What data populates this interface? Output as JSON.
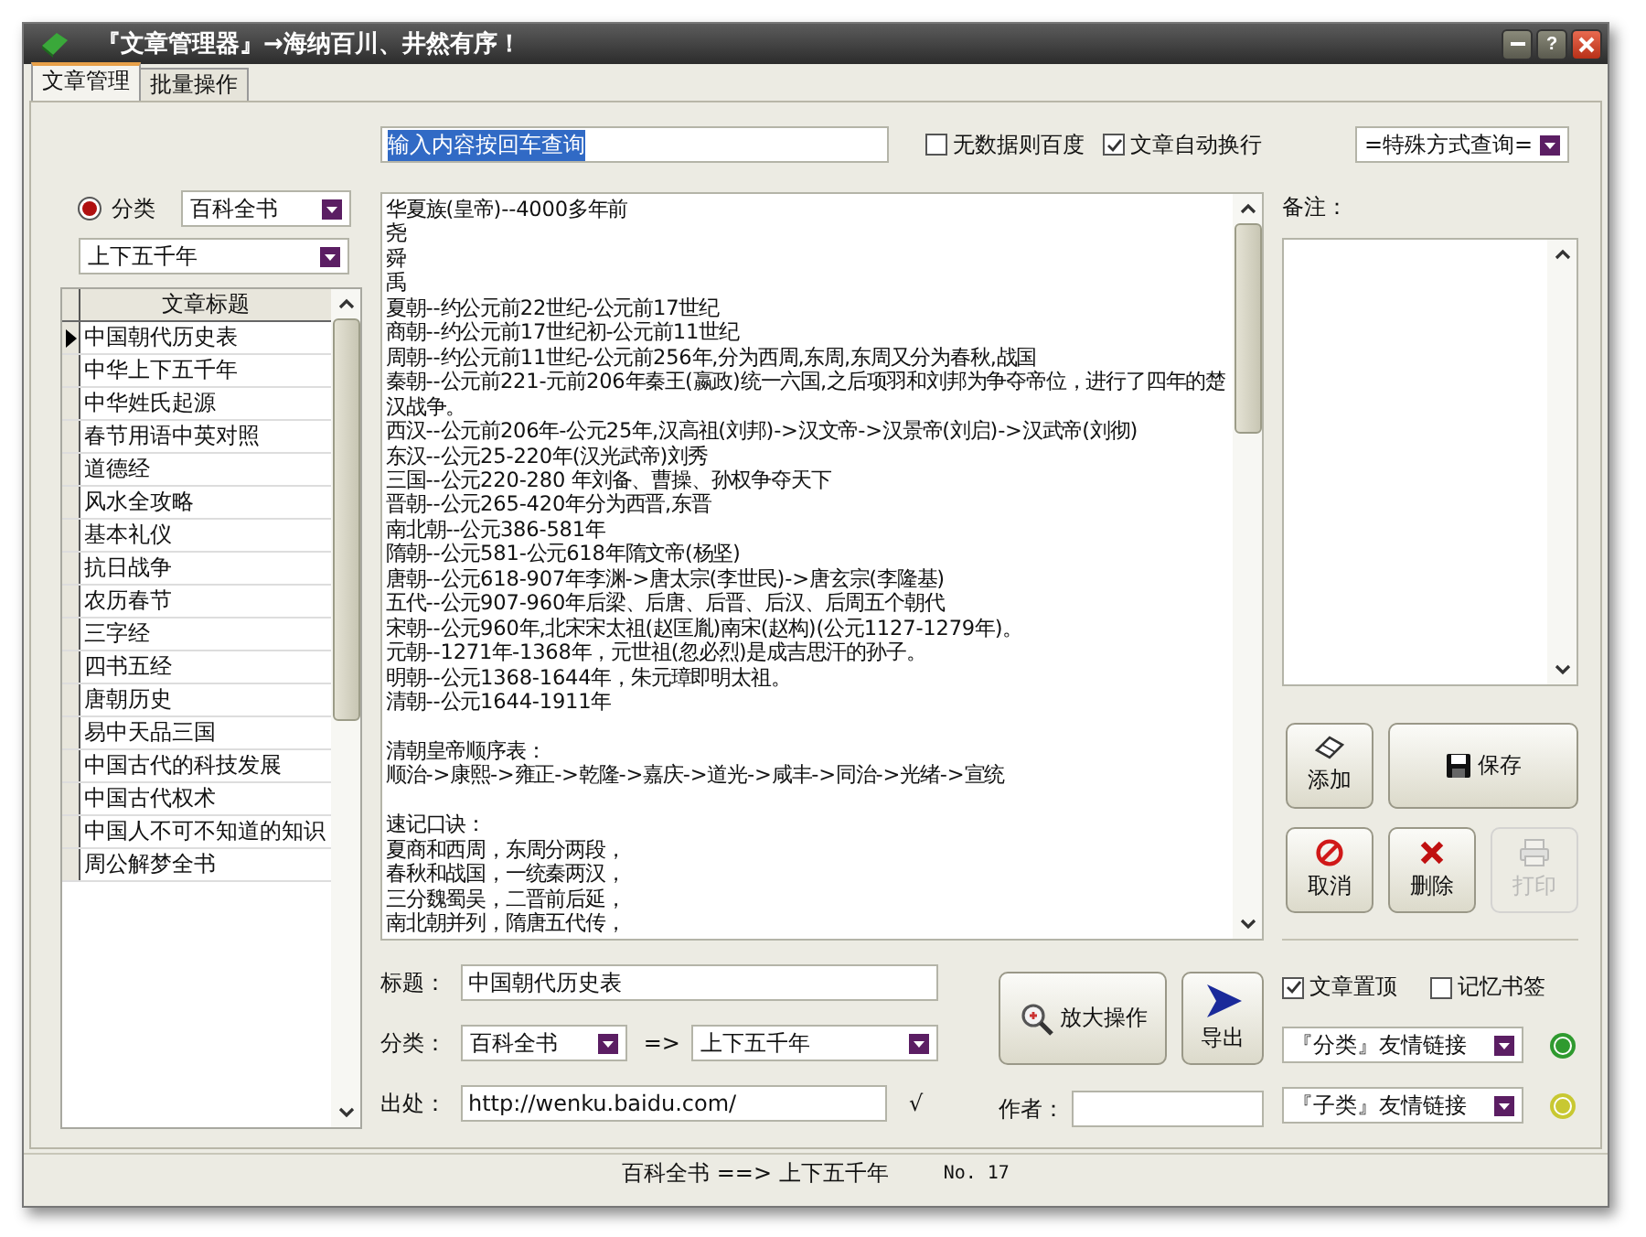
{
  "window": {
    "title": "『文章管理器』→海纳百川、井然有序！",
    "help_button": "?"
  },
  "tabs": [
    {
      "label": "文章管理",
      "selected": true
    },
    {
      "label": "批量操作",
      "selected": false
    }
  ],
  "search": {
    "value": "输入内容按回车查询"
  },
  "top_options": [
    {
      "label": "无数据则百度",
      "checked": false
    },
    {
      "label": "文章自动换行",
      "checked": true
    }
  ],
  "query_mode": {
    "value": "=特殊方式查询="
  },
  "category": {
    "label": "分类",
    "selected": true,
    "value": "百科全书"
  },
  "subcategory": {
    "value": "上下五千年"
  },
  "article_list": {
    "column": "文章标题",
    "rows": [
      {
        "title": "中国朝代历史表",
        "selected": true
      },
      {
        "title": "中华上下五千年",
        "selected": false
      },
      {
        "title": "中华姓氏起源",
        "selected": false
      },
      {
        "title": "春节用语中英对照",
        "selected": false
      },
      {
        "title": "道德经",
        "selected": false
      },
      {
        "title": "风水全攻略",
        "selected": false
      },
      {
        "title": "基本礼仪",
        "selected": false
      },
      {
        "title": "抗日战争",
        "selected": false
      },
      {
        "title": "农历春节",
        "selected": false
      },
      {
        "title": "三字经",
        "selected": false
      },
      {
        "title": "四书五经",
        "selected": false
      },
      {
        "title": "唐朝历史",
        "selected": false
      },
      {
        "title": "易中天品三国",
        "selected": false
      },
      {
        "title": "中国古代的科技发展",
        "selected": false
      },
      {
        "title": "中国古代权术",
        "selected": false
      },
      {
        "title": "中国人不可不知道的知识",
        "selected": false
      },
      {
        "title": "周公解梦全书",
        "selected": false
      }
    ]
  },
  "content": {
    "sections": [
      [
        "华夏族(皇帝)--4000多年前",
        "尧",
        "舜",
        "禹",
        "夏朝--约公元前22世纪-公元前17世纪",
        "商朝--约公元前17世纪初-公元前11世纪",
        "周朝--约公元前11世纪-公元前256年,分为西周,东周,东周又分为春秋,战国",
        "秦朝--公元前221-元前206年秦王(嬴政)统一六国,之后项羽和刘邦为争夺帝位，进行了四年的楚汉战争。",
        "西汉--公元前206年-公元25年,汉高祖(刘邦)->汉文帝->汉景帝(刘启)->汉武帝(刘彻)",
        "东汉--公元25-220年(汉光武帝)刘秀",
        "三国--公元220-280 年刘备、曹操、孙权争夺天下",
        "晋朝--公元265-420年分为西晋,东晋",
        "南北朝--公元386-581年",
        "隋朝--公元581-公元618年隋文帝(杨坚)",
        "唐朝--公元618-907年李渊->唐太宗(李世民)->唐玄宗(李隆基)",
        "五代--公元907-960年后梁、后唐、后晋、后汉、后周五个朝代",
        "宋朝--公元960年,北宋宋太祖(赵匡胤)南宋(赵构)(公元1127-1279年)。",
        "元朝--1271年-1368年，元世祖(忽必烈)是成吉思汗的孙子。",
        "明朝--公元1368-1644年，朱元璋即明太祖。",
        "清朝--公元1644-1911年"
      ],
      [
        "清朝皇帝顺序表：",
        "顺治->康熙->雍正->乾隆->嘉庆->道光->咸丰->同治->光绪->宣统"
      ],
      [
        "速记口诀：",
        "夏商和西周，东周分两段，",
        "春秋和战国，一统秦两汉，",
        "三分魏蜀吴，二晋前后延，",
        "南北朝并列，隋唐五代传，"
      ]
    ]
  },
  "notes": {
    "label": "备注："
  },
  "action_buttons": [
    {
      "label": "添加",
      "kind": "add",
      "disabled": false
    },
    {
      "label": "保存",
      "kind": "save",
      "disabled": false
    },
    {
      "label": "取消",
      "kind": "cancel",
      "disabled": false
    },
    {
      "label": "删除",
      "kind": "delete",
      "disabled": false
    },
    {
      "label": "打印",
      "kind": "print",
      "disabled": true
    }
  ],
  "side_options": [
    {
      "label": "文章置顶",
      "checked": true
    },
    {
      "label": "记忆书签",
      "checked": false
    }
  ],
  "link_selectors": [
    {
      "value": "『分类』友情链接",
      "color": "#2f9a2f"
    },
    {
      "value": "『子类』友情链接",
      "color": "#c8c832"
    }
  ],
  "form": {
    "title_label": "标题：",
    "title_value": "中国朝代历史表",
    "category_label": "分类：",
    "category_value": "百科全书",
    "arrow": "=>",
    "subcategory_value": "上下五千年",
    "source_label": "出处：",
    "source_value": "http://wenku.baidu.com/",
    "source_mark": "√",
    "author_label": "作者："
  },
  "tool_buttons": [
    {
      "label": "放大操作",
      "kind": "zoom"
    },
    {
      "label": "导出",
      "kind": "export"
    }
  ],
  "status_bar": {
    "path": "百科全书 ==> 上下五千年",
    "number": "No. 17"
  }
}
